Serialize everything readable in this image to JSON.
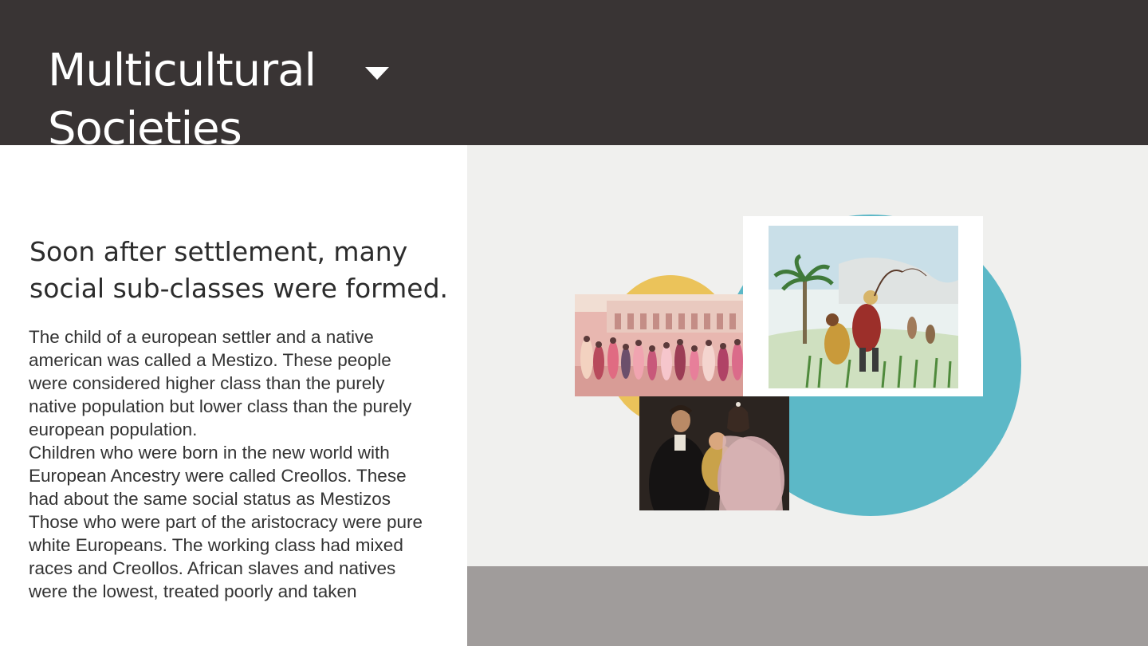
{
  "header": {
    "title_line1": "Multicultural",
    "title_line2": "Societies"
  },
  "content": {
    "subtitle_line1": "Soon after settlement, many",
    "subtitle_line2": "social sub-classes were formed.",
    "body_lines": [
      "The child of a european settler and a native",
      "american was called a Mestizo.  These people",
      "were considered higher class than the purely",
      "native population but lower class than the purely",
      "european population.",
      "Children who were born in the new world with",
      "European Ancestry were called Creollos.  These",
      "had about the same social status as Mestizos",
      "Those who were part of the aristocracy were pure",
      "white Europeans.  The working class had mixed",
      "races and Creollos.  African slaves and natives",
      "were the lowest, treated poorly and taken"
    ]
  },
  "icons": {
    "dropdown": "chevron-down-icon"
  },
  "colors": {
    "header_bg": "#393434",
    "right_panel_bg": "#f0f0ee",
    "bottom_band": "#a09c9b",
    "teal_circle": "#5cb8c7",
    "yellow_circle": "#ebc35a"
  }
}
